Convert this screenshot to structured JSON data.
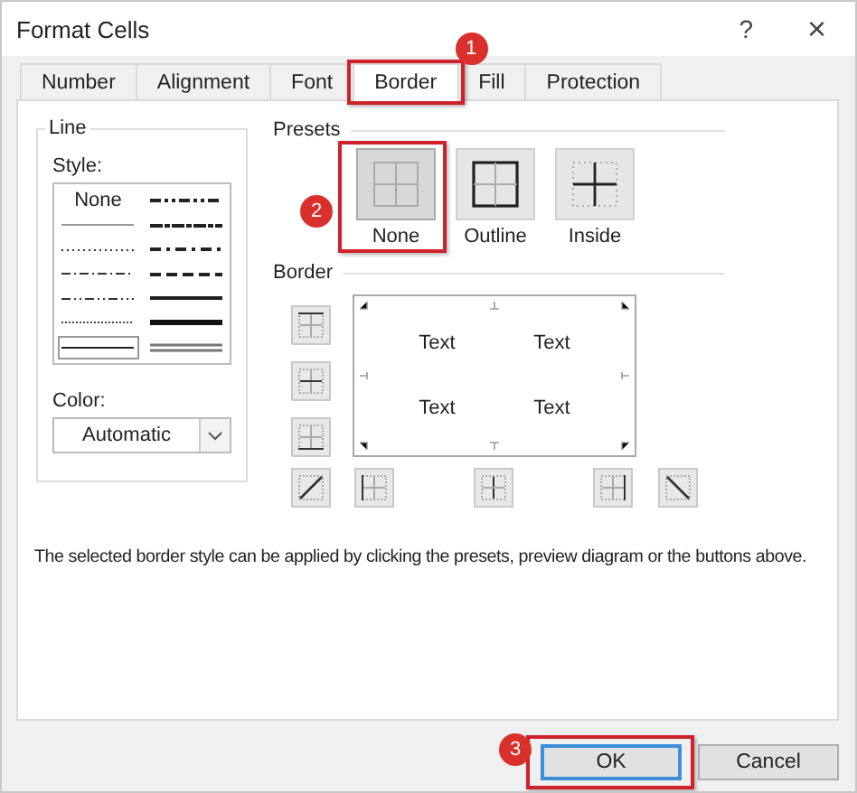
{
  "window": {
    "title": "Format Cells",
    "help": "?",
    "close": "×"
  },
  "tabs": [
    {
      "label": "Number",
      "selected": false
    },
    {
      "label": "Alignment",
      "selected": false
    },
    {
      "label": "Font",
      "selected": false
    },
    {
      "label": "Border",
      "selected": true,
      "annotation": "1"
    },
    {
      "label": "Fill",
      "selected": false
    },
    {
      "label": "Protection",
      "selected": false
    }
  ],
  "line": {
    "title": "Line",
    "style_label": "Style:",
    "styles": [
      {
        "kind": "none",
        "label": "None",
        "selected": false
      },
      {
        "kind": "hair",
        "selected": false
      },
      {
        "kind": "dotted",
        "selected": false
      },
      {
        "kind": "dashdot",
        "selected": false
      },
      {
        "kind": "dashdotdot",
        "selected": false
      },
      {
        "kind": "dashed",
        "selected": false
      },
      {
        "kind": "thin",
        "selected": true
      },
      {
        "kind": "dashdotdot-medium",
        "selected": false
      },
      {
        "kind": "slanted",
        "selected": false
      },
      {
        "kind": "dashdot-medium",
        "selected": false
      },
      {
        "kind": "dashed-medium",
        "selected": false
      },
      {
        "kind": "medium",
        "selected": false
      },
      {
        "kind": "thick",
        "selected": false
      },
      {
        "kind": "double",
        "selected": false
      }
    ],
    "color_label": "Color:",
    "color_value": "Automatic"
  },
  "presets": {
    "title": "Presets",
    "items": [
      {
        "kind": "none",
        "label": "None",
        "selected": true,
        "annotation": "2"
      },
      {
        "kind": "outline",
        "label": "Outline",
        "selected": false
      },
      {
        "kind": "inside",
        "label": "Inside",
        "selected": false
      }
    ]
  },
  "border": {
    "title": "Border",
    "preview_texts": [
      "Text",
      "Text",
      "Text",
      "Text"
    ]
  },
  "description": "The selected border style can be applied by clicking the presets, preview diagram or the buttons above.",
  "buttons": [
    {
      "label": "OK",
      "default": true,
      "annotation": "3"
    },
    {
      "label": "Cancel",
      "default": false
    }
  ]
}
